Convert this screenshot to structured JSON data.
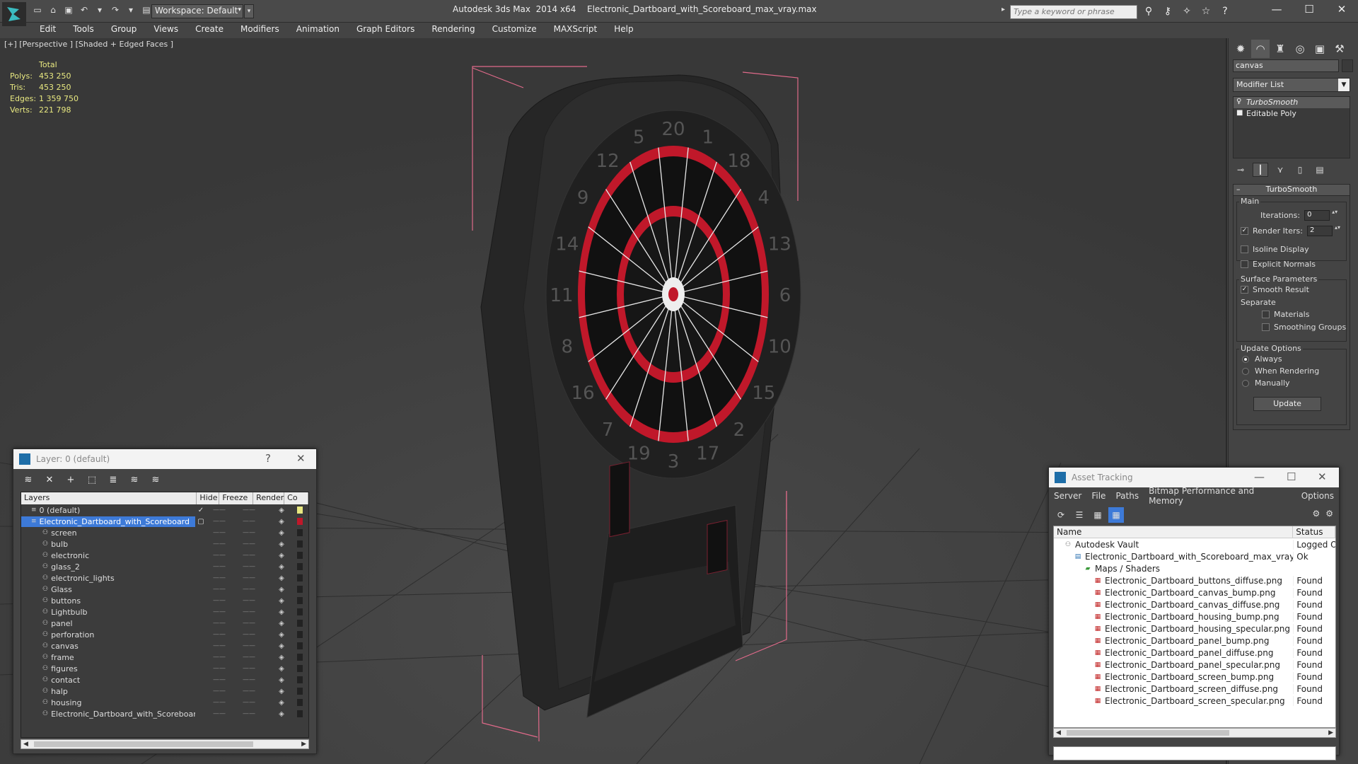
{
  "app": {
    "title": "Autodesk 3ds Max  2014 x64",
    "file": "Electronic_Dartboard_with_Scoreboard_max_vray.max",
    "workspace": "Workspace: Default",
    "search_placeholder": "Type a keyword or phrase"
  },
  "menu": [
    "Edit",
    "Tools",
    "Group",
    "Views",
    "Create",
    "Modifiers",
    "Animation",
    "Graph Editors",
    "Rendering",
    "Customize",
    "MAXScript",
    "Help"
  ],
  "viewport": {
    "label": "[+] [Perspective ] [Shaded + Edged Faces ]",
    "stats": {
      "header": "Total",
      "rows": [
        {
          "label": "Polys:",
          "value": "453 250"
        },
        {
          "label": "Tris:",
          "value": "453 250"
        },
        {
          "label": "Edges:",
          "value": "1 359 750"
        },
        {
          "label": "Verts:",
          "value": "221 798"
        }
      ]
    },
    "dartboard_numbers": [
      "20",
      "1",
      "18",
      "4",
      "13",
      "6",
      "10",
      "15",
      "2",
      "17",
      "3",
      "19",
      "7",
      "16",
      "8",
      "11",
      "14",
      "9",
      "12",
      "5"
    ]
  },
  "command_panel": {
    "object_name": "canvas",
    "modifier_list": "Modifier List",
    "stack": [
      {
        "label": "TurboSmooth",
        "selected": true
      },
      {
        "label": "Editable Poly",
        "selected": false
      }
    ],
    "rollout": {
      "title": "TurboSmooth",
      "main_label": "Main",
      "iterations_label": "Iterations:",
      "iterations_value": "0",
      "render_iters_label": "Render Iters:",
      "render_iters_value": "2",
      "isoline_label": "Isoline Display",
      "explicit_normals_label": "Explicit Normals",
      "surface_label": "Surface Parameters",
      "smooth_result_label": "Smooth Result",
      "separate_label": "Separate",
      "materials_label": "Materials",
      "smoothing_groups_label": "Smoothing Groups",
      "update_options_label": "Update Options",
      "always_label": "Always",
      "when_rendering_label": "When Rendering",
      "manually_label": "Manually",
      "update_button": "Update"
    }
  },
  "layer_panel": {
    "title": "Layer: 0 (default)",
    "help": "?",
    "close": "✕",
    "columns": [
      "Layers",
      "Hide",
      "Freeze",
      "Render",
      "Co"
    ],
    "rows": [
      {
        "name": "0 (default)",
        "level": 0,
        "current": true,
        "selected": false
      },
      {
        "name": "Electronic_Dartboard_with_Scoreboard",
        "level": 0,
        "current": false,
        "selected": true
      },
      {
        "name": "screen",
        "level": 1
      },
      {
        "name": "bulb",
        "level": 1
      },
      {
        "name": "electronic",
        "level": 1
      },
      {
        "name": "glass_2",
        "level": 1
      },
      {
        "name": "electronic_lights",
        "level": 1
      },
      {
        "name": "Glass",
        "level": 1
      },
      {
        "name": "buttons",
        "level": 1
      },
      {
        "name": "Lightbulb",
        "level": 1
      },
      {
        "name": "panel",
        "level": 1
      },
      {
        "name": "perforation",
        "level": 1
      },
      {
        "name": "canvas",
        "level": 1
      },
      {
        "name": "frame",
        "level": 1
      },
      {
        "name": "figures",
        "level": 1
      },
      {
        "name": "contact",
        "level": 1
      },
      {
        "name": "halp",
        "level": 1
      },
      {
        "name": "housing",
        "level": 1
      },
      {
        "name": "Electronic_Dartboard_with_Scoreboard",
        "level": 1
      }
    ]
  },
  "asset_panel": {
    "title": "Asset Tracking",
    "menu": [
      "Server",
      "File",
      "Paths",
      "Bitmap Performance and Memory",
      "Options"
    ],
    "columns": [
      "Name",
      "Status"
    ],
    "rows": [
      {
        "name": "Autodesk Vault",
        "status": "Logged Ou",
        "level": 0,
        "type": "vault"
      },
      {
        "name": "Electronic_Dartboard_with_Scoreboard_max_vray.max",
        "status": "Ok",
        "level": 1,
        "type": "max"
      },
      {
        "name": "Maps / Shaders",
        "status": "",
        "level": 2,
        "type": "folder"
      },
      {
        "name": "Electronic_Dartboard_buttons_diffuse.png",
        "status": "Found",
        "level": 3,
        "type": "png"
      },
      {
        "name": "Electronic_Dartboard_canvas_bump.png",
        "status": "Found",
        "level": 3,
        "type": "png"
      },
      {
        "name": "Electronic_Dartboard_canvas_diffuse.png",
        "status": "Found",
        "level": 3,
        "type": "png"
      },
      {
        "name": "Electronic_Dartboard_housing_bump.png",
        "status": "Found",
        "level": 3,
        "type": "png"
      },
      {
        "name": "Electronic_Dartboard_housing_specular.png",
        "status": "Found",
        "level": 3,
        "type": "png"
      },
      {
        "name": "Electronic_Dartboard_panel_bump.png",
        "status": "Found",
        "level": 3,
        "type": "png"
      },
      {
        "name": "Electronic_Dartboard_panel_diffuse.png",
        "status": "Found",
        "level": 3,
        "type": "png"
      },
      {
        "name": "Electronic_Dartboard_panel_specular.png",
        "status": "Found",
        "level": 3,
        "type": "png"
      },
      {
        "name": "Electronic_Dartboard_screen_bump.png",
        "status": "Found",
        "level": 3,
        "type": "png"
      },
      {
        "name": "Electronic_Dartboard_screen_diffuse.png",
        "status": "Found",
        "level": 3,
        "type": "png"
      },
      {
        "name": "Electronic_Dartboard_screen_specular.png",
        "status": "Found",
        "level": 3,
        "type": "png"
      }
    ]
  },
  "colors": {
    "selection": "#3d7ad8",
    "dart_red": "#c0182a",
    "bbox": "#e06a8a",
    "stats_text": "#e8e880"
  }
}
